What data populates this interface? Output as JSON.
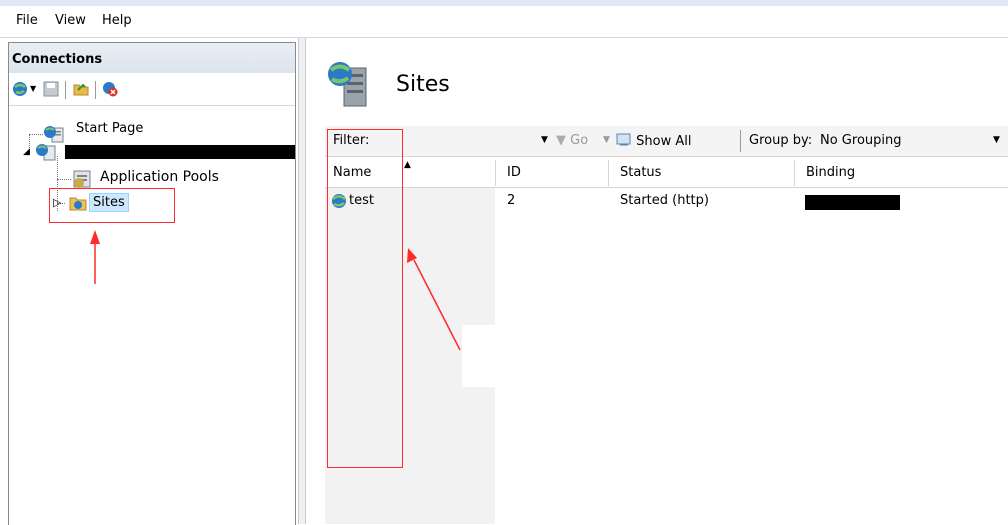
{
  "menu": {
    "file": "File",
    "view": "View",
    "help": "Help"
  },
  "connections": {
    "title": "Connections",
    "toolbar_icons": [
      "connect-icon",
      "save-icon",
      "folder-icon",
      "disconnect-icon"
    ],
    "tree": {
      "start_page": "Start Page",
      "application_pools": "Application Pools",
      "sites": "Sites"
    }
  },
  "main": {
    "title": "Sites",
    "filter": {
      "label": "Filter:",
      "go": "Go",
      "show_all": "Show All",
      "group_by_label": "Group by:",
      "group_by_value": "No Grouping"
    },
    "columns": [
      "Name",
      "ID",
      "Status",
      "Binding"
    ],
    "rows": [
      {
        "name": "test",
        "id": "2",
        "status": "Started (http)"
      }
    ]
  },
  "colors": {
    "annotation": "#ff2a2a",
    "panel_header": "#dce4ec",
    "selection": "#cce8ff"
  }
}
